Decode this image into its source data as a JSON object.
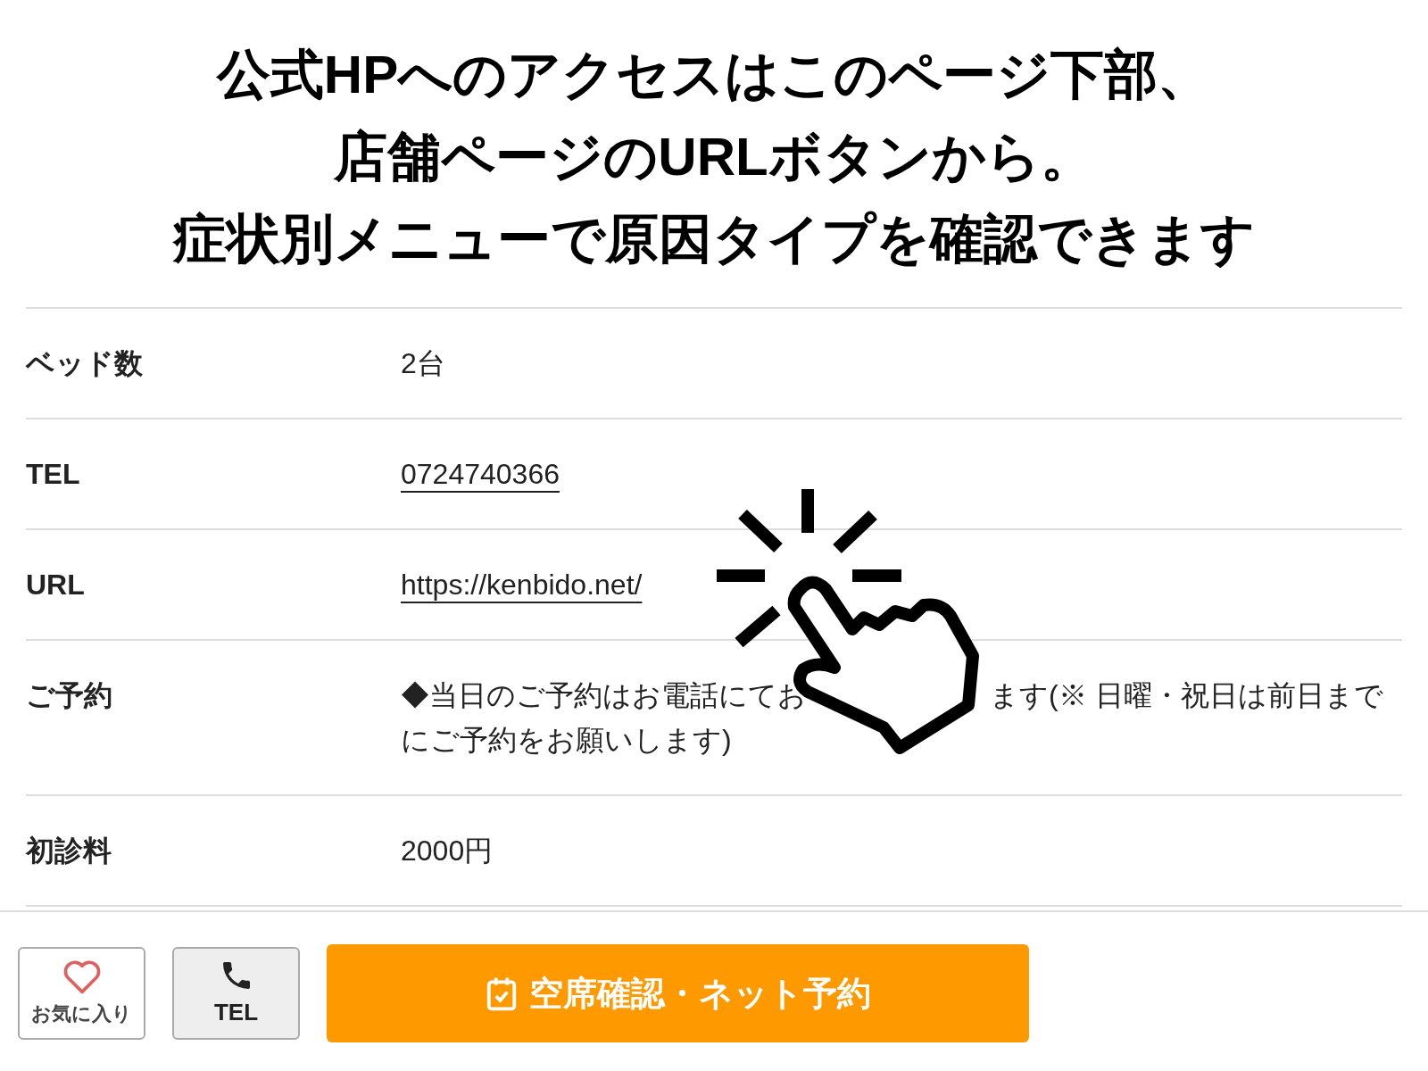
{
  "headline": [
    "公式HPへのアクセスはこのページ下部、",
    "店舗ページのURLボタンから。",
    "症状別メニューで原因タイプを確認できます"
  ],
  "rows": [
    {
      "kind": "text",
      "label": "ベッド数",
      "value": [
        "2台"
      ]
    },
    {
      "kind": "link",
      "label": "TEL",
      "value": [
        "0724740366"
      ]
    },
    {
      "kind": "link",
      "label": "URL",
      "value": [
        "https://kenbido.net/"
      ]
    },
    {
      "kind": "text",
      "label": "ご予約",
      "value": [
        "◆当日のご予約はお電話にてお",
        "ます(※ 日曜・祝日は前日までにご予約をお願いします)"
      ]
    },
    {
      "kind": "text",
      "label": "初診料",
      "value": [
        "2000円"
      ]
    }
  ],
  "bottom_bar": {
    "favorite": "お気に入り",
    "tel": "TEL",
    "reserve": "空席確認・ネット予約"
  }
}
